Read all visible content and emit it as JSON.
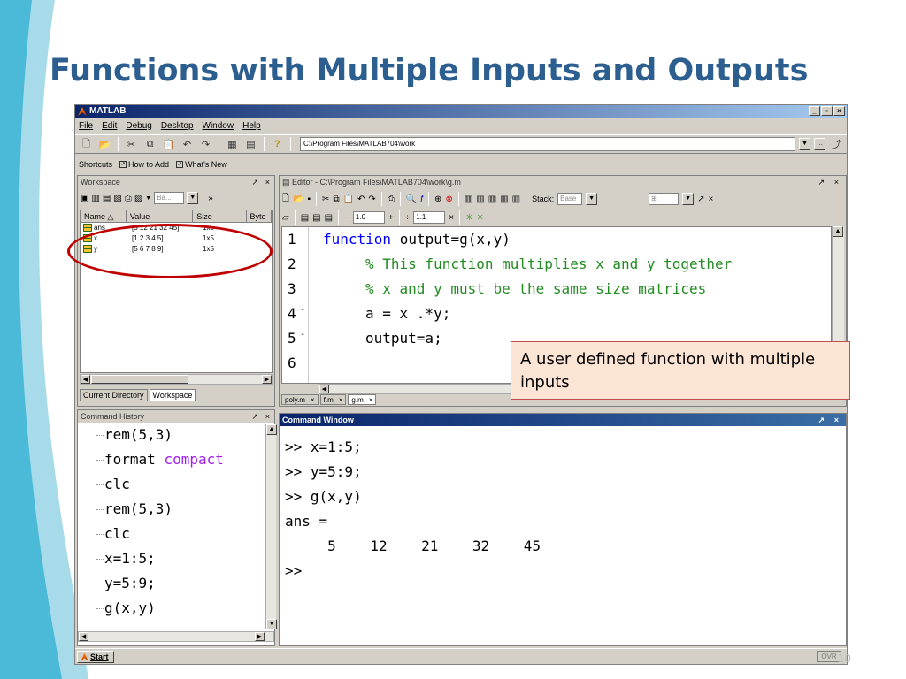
{
  "slide": {
    "title": "Functions with Multiple Inputs and Outputs",
    "number": "10"
  },
  "colors": {
    "title": "#2c5f8f",
    "keyword": "#0000ff",
    "comment": "#228b22",
    "purple": "#a020f0",
    "highlight": "#c00000",
    "callout_bg": "#fde5d5"
  },
  "app": {
    "title": "MATLAB",
    "menus": [
      "File",
      "Edit",
      "Debug",
      "Desktop",
      "Window",
      "Help"
    ],
    "current_directory": "C:\\Program Files\\MATLAB704\\work",
    "shortcuts": {
      "label": "Shortcuts",
      "how_to_add": "How to Add",
      "whats_new": "What's New"
    }
  },
  "workspace": {
    "title": "Workspace",
    "base": "Ba...",
    "columns": [
      "Name",
      "Value",
      "Size",
      "Byte"
    ],
    "rows": [
      {
        "name": "ans",
        "value": "[5 12 21 32 45]",
        "size": "1x5"
      },
      {
        "name": "x",
        "value": "[1 2 3 4 5]",
        "size": "1x5"
      },
      {
        "name": "y",
        "value": "[5 6 7 8 9]",
        "size": "1x5"
      }
    ],
    "tabs": [
      "Current Directory",
      "Workspace"
    ]
  },
  "history": {
    "title": "Command History",
    "lines": [
      "rem(5,3)",
      "format",
      "clc",
      "rem(5,3)",
      "clc",
      "x=1:5;",
      "y=5:9;",
      "g(x,y)"
    ],
    "format_arg": "compact"
  },
  "editor": {
    "title": "Editor - C:\\Program Files\\MATLAB704\\work\\g.m",
    "stack_label": "Stack:",
    "stack_value": "Base",
    "cell_step1": "1.0",
    "cell_step2": "1.1",
    "lines": [
      {
        "num": "1",
        "kw": "function",
        "text": " output=g(x,y)",
        "dash": ""
      },
      {
        "num": "2",
        "comment": "% This function multiplies x and y together",
        "dash": ""
      },
      {
        "num": "3",
        "comment": "% x and y must be the same size matrices",
        "dash": ""
      },
      {
        "num": "4",
        "text": "a = x .*y;",
        "dash": "-"
      },
      {
        "num": "5",
        "text": "output=a;",
        "dash": "-"
      },
      {
        "num": "6",
        "text": "",
        "dash": ""
      }
    ],
    "tabs": [
      "poly.m",
      "f.m",
      "g.m"
    ]
  },
  "command_window": {
    "title": "Command Window",
    "lines": [
      ">> x=1:5;",
      ">> y=5:9;",
      ">> g(x,y)",
      "ans =",
      "     5    12    21    32    45",
      ">>"
    ]
  },
  "status": {
    "start": "Start",
    "ovr": "OVR"
  },
  "callout": {
    "text": "A user defined function with multiple inputs"
  }
}
